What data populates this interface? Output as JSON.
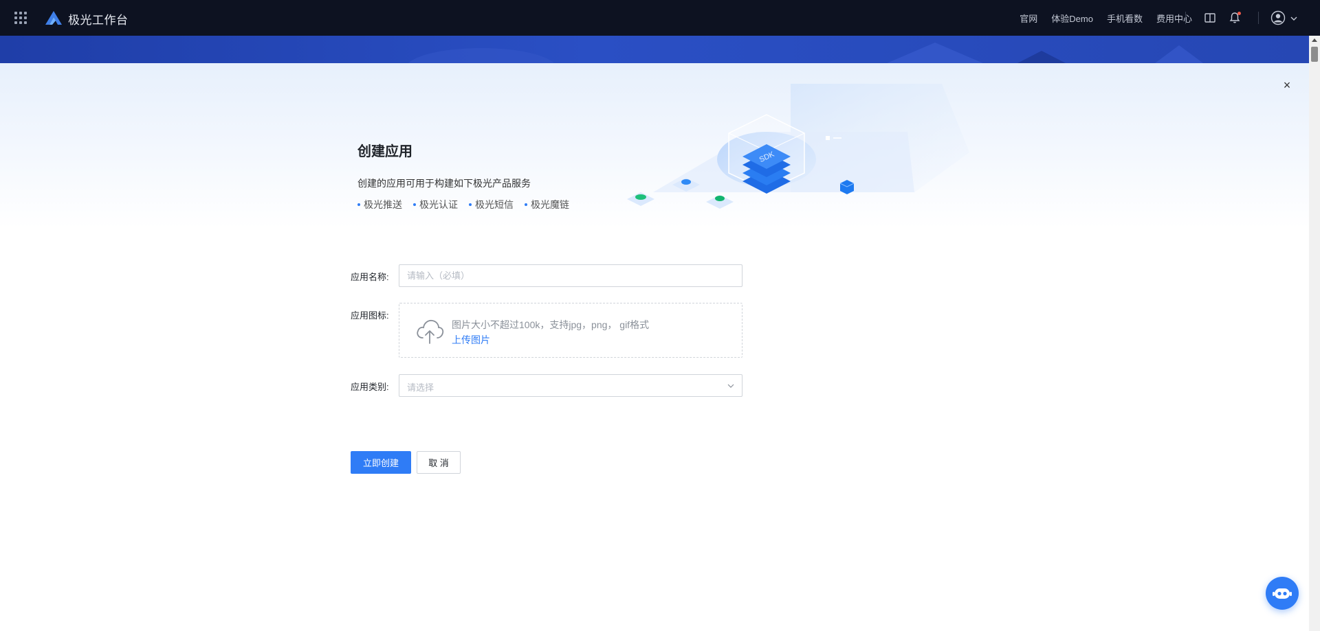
{
  "topbar": {
    "app_title": "极光工作台",
    "nav_links": [
      "官网",
      "体验Demo",
      "手机看数",
      "费用中心"
    ],
    "icons": [
      "apps-grid-icon",
      "jiguang-logo",
      "book-icon",
      "bell-icon",
      "user-avatar-icon",
      "chevron-down-icon"
    ]
  },
  "hero": {
    "title": "创建应用",
    "description": "创建的应用可用于构建如下极光产品服务",
    "tags": [
      "极光推送",
      "极光认证",
      "极光短信",
      "极光魔链"
    ],
    "illustration_text": "SDK"
  },
  "form": {
    "name_label": "应用名称:",
    "name_placeholder": "请输入（必填）",
    "name_value": "",
    "icon_label": "应用图标:",
    "upload_hint": "图片大小不超过100k，支持jpg，png， gif格式",
    "upload_link": "上传图片",
    "category_label": "应用类别:",
    "category_placeholder": "请选择"
  },
  "actions": {
    "create_label": "立即创建",
    "cancel_label": "取 消"
  },
  "close_label": "×",
  "colors": {
    "topbar_bg": "#0d1221",
    "banner_bg": "#2a4fc4",
    "primary": "#2f7cf6"
  }
}
